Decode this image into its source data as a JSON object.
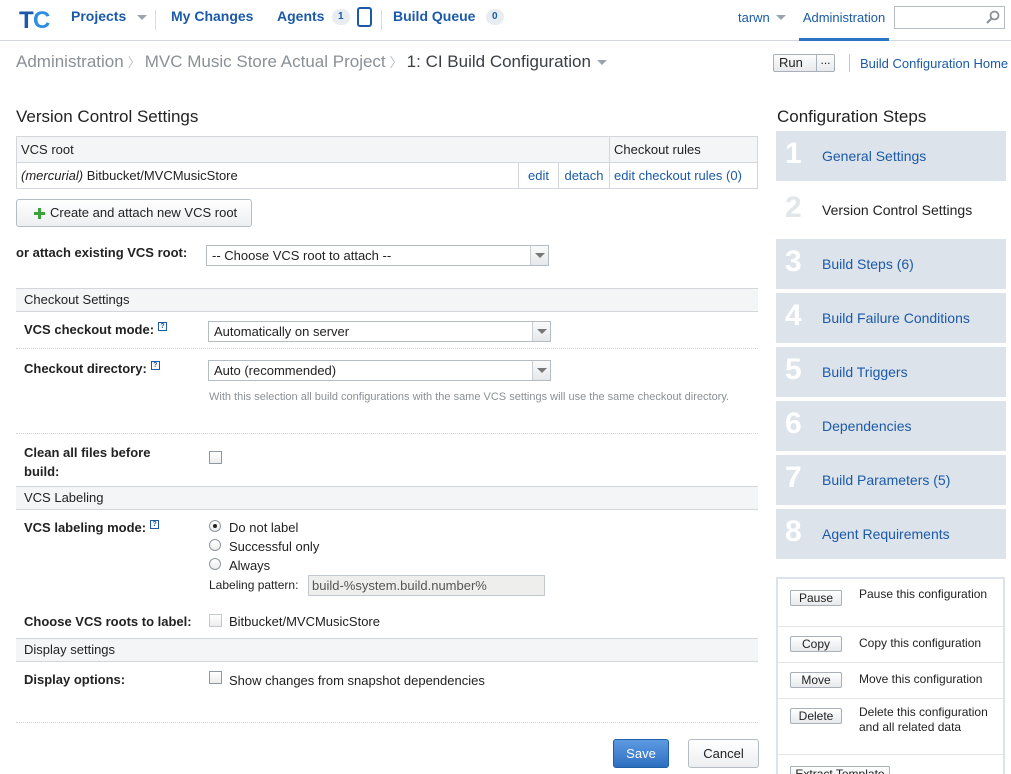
{
  "topnav": {
    "projects": "Projects",
    "my_changes": "My Changes",
    "agents": "Agents",
    "agents_count": "1",
    "build_queue": "Build Queue",
    "build_queue_count": "0",
    "user": "tarwn",
    "administration": "Administration",
    "search_placeholder": ""
  },
  "breadcrumb": {
    "items": [
      "Administration",
      "MVC Music Store Actual Project",
      "1: CI Build Configuration"
    ],
    "run_label": "Run",
    "run_more": "...",
    "home_link": "Build Configuration Home"
  },
  "vcs": {
    "title": "Version Control Settings",
    "columns": [
      "VCS root",
      "Checkout rules"
    ],
    "rows": [
      {
        "type": "(mercurial)",
        "name": "Bitbucket/MVCMusicStore",
        "edit": "edit",
        "detach": "detach",
        "rules": "edit checkout rules (0)"
      }
    ],
    "create_button": "Create and attach new VCS root",
    "attach_label": "or attach existing VCS root:",
    "attach_select": "-- Choose VCS root to attach --"
  },
  "checkout": {
    "header": "Checkout Settings",
    "mode_label": "VCS checkout mode:",
    "mode_value": "Automatically on server",
    "dir_label": "Checkout directory:",
    "dir_value": "Auto (recommended)",
    "dir_note": "With this selection all build configurations with the same VCS settings will use the same checkout directory.",
    "clean_label": "Clean all files before build:"
  },
  "labeling": {
    "header": "VCS Labeling",
    "mode_label": "VCS labeling mode:",
    "options": [
      "Do not label",
      "Successful only",
      "Always"
    ],
    "selected": "Do not label",
    "pattern_label": "Labeling pattern:",
    "pattern_value": "build-%system.build.number%",
    "roots_label": "Choose VCS roots to label:",
    "roots": [
      "Bitbucket/MVCMusicStore"
    ]
  },
  "display": {
    "header": "Display settings",
    "options_label": "Display options:",
    "option": "Show changes from snapshot dependencies"
  },
  "buttons": {
    "save": "Save",
    "cancel": "Cancel"
  },
  "sidebar": {
    "title": "Configuration Steps",
    "steps": [
      {
        "num": "1",
        "label": "General Settings"
      },
      {
        "num": "2",
        "label": "Version Control Settings"
      },
      {
        "num": "3",
        "label": "Build Steps (6)"
      },
      {
        "num": "4",
        "label": "Build Failure Conditions"
      },
      {
        "num": "5",
        "label": "Build Triggers"
      },
      {
        "num": "6",
        "label": "Dependencies"
      },
      {
        "num": "7",
        "label": "Build Parameters (5)"
      },
      {
        "num": "8",
        "label": "Agent Requirements"
      }
    ],
    "actions": [
      {
        "button": "Pause",
        "text": "Pause this configuration"
      },
      {
        "button": "Copy",
        "text": "Copy this configuration"
      },
      {
        "button": "Move",
        "text": "Move this configuration"
      },
      {
        "button": "Delete",
        "text": "Delete this configuration and all related data"
      },
      {
        "button": "Extract Template",
        "text": ""
      }
    ]
  },
  "colors": {
    "link": "#1b5aa8",
    "accent": "#2b73c4",
    "step_bg": "#dde3ea",
    "save_bg": "#2e6fc0"
  }
}
